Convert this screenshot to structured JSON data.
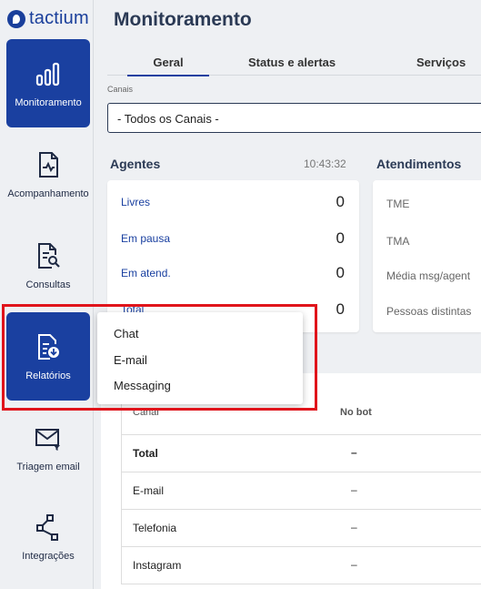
{
  "brand": {
    "name": "tactium",
    "color": "#1a3f9b"
  },
  "sidebar": {
    "items": [
      {
        "label": "Monitoramento",
        "icon": "bar-chart-icon",
        "active": true
      },
      {
        "label": "Acompanhamento",
        "icon": "document-chart-icon",
        "active": false
      },
      {
        "label": "Consultas",
        "icon": "document-search-icon",
        "active": false
      },
      {
        "label": "Relatórios",
        "icon": "report-download-icon",
        "active": true
      },
      {
        "label": "Triagem email",
        "icon": "mail-filter-icon",
        "active": false
      },
      {
        "label": "Integrações",
        "icon": "share-nodes-icon",
        "active": false
      }
    ]
  },
  "page": {
    "title": "Monitoramento"
  },
  "tabs": [
    {
      "label": "Geral",
      "active": true
    },
    {
      "label": "Status e alertas",
      "active": false
    },
    {
      "label": "Serviços",
      "active": false
    }
  ],
  "canais": {
    "label": "Canais",
    "value": "- Todos os Canais -"
  },
  "agentes": {
    "title": "Agentes",
    "time": "10:43:32",
    "rows": [
      {
        "label": "Livres",
        "value": "0"
      },
      {
        "label": "Em pausa",
        "value": "0"
      },
      {
        "label": "Em atend.",
        "value": "0"
      },
      {
        "label": "Total",
        "value": "0"
      }
    ]
  },
  "atendimentos": {
    "title": "Atendimentos",
    "rows": [
      "TME",
      "TMA",
      "Média msg/agent",
      "Pessoas distintas"
    ]
  },
  "table": {
    "headers": [
      "Canal",
      "No bot"
    ],
    "rows": [
      {
        "canal": "Total",
        "nobot": "–"
      },
      {
        "canal": "E-mail",
        "nobot": "–"
      },
      {
        "canal": "Telefonia",
        "nobot": "–"
      },
      {
        "canal": "Instagram",
        "nobot": "–"
      }
    ]
  },
  "dropdown": {
    "options": [
      "Chat",
      "E-mail",
      "Messaging"
    ]
  },
  "colors": {
    "accent": "#1a40a0",
    "highlight": "#e0141b"
  }
}
